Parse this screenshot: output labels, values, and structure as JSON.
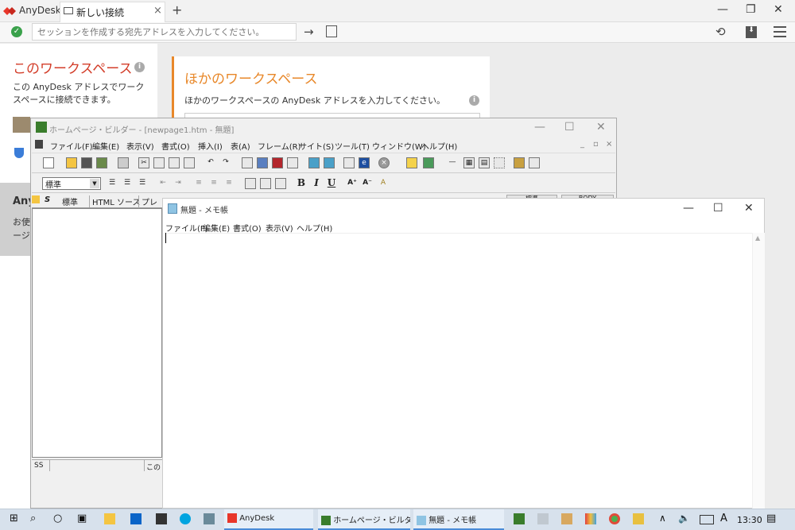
{
  "anydesk": {
    "app_name": "AnyDesk",
    "tab_label": "新しい接続",
    "tab_close": "×",
    "new_tab": "+",
    "address_placeholder": "セッションを作成する宛先アドレスを入力してください。",
    "this_workspace": {
      "title": "このワークスペース",
      "desc": "この AnyDesk アドレスでワークスペースに接続できます。"
    },
    "other_workspace": {
      "title": "ほかのワークスペース",
      "desc": "ほかのワークスペースの AnyDesk アドレスを入力してください。"
    },
    "gray_panel": {
      "title": "Any",
      "line1": "お使",
      "line2": "ージ"
    },
    "window_controls": {
      "minimize": "—",
      "maximize": "❐",
      "close": "✕"
    },
    "accent": "#d33e2a",
    "other_accent": "#e8882a"
  },
  "homepage_builder": {
    "title": "ホームページ・ビルダー - [newpage1.htm - 無題]",
    "menu": [
      "ファイル(F)",
      "編集(E)",
      "表示(V)",
      "書式(O)",
      "挿入(I)",
      "表(A)",
      "フレーム(R)",
      "サイト(S)",
      "ツール(T)",
      "ウィンドウ(W)",
      "ヘルプ(H)"
    ],
    "style_select": "標準",
    "format_buttons": {
      "bold": "B",
      "italic": "I",
      "underline": "U"
    },
    "tabs": [
      "標準",
      "HTML ソース",
      "プレビ"
    ],
    "tab_icons": {
      "s": "S"
    },
    "status_left": "SS",
    "status_right": "この",
    "status_chip1": "標準",
    "status_chip2": "BODY",
    "window_controls": {
      "minimize": "—",
      "maximize": "☐",
      "close": "✕"
    }
  },
  "notepad": {
    "title": "無題 - メモ帳",
    "menu": [
      "ファイル(F)",
      "編集(E)",
      "書式(O)",
      "表示(V)",
      "ヘルプ(H)"
    ],
    "content": "",
    "window_controls": {
      "minimize": "—",
      "maximize": "☐",
      "close": "✕"
    }
  },
  "taskbar": {
    "apps": [
      {
        "label": "AnyDesk"
      },
      {
        "label": "ホームページ・ビルダー ..."
      },
      {
        "label": "無題 - メモ帳"
      }
    ],
    "ime": "A",
    "clock": "13:30"
  }
}
